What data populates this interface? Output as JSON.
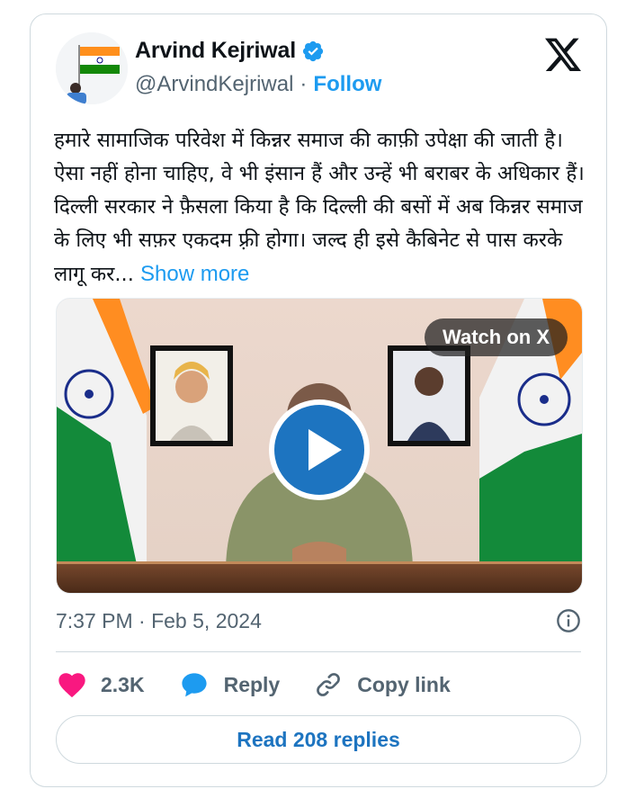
{
  "author": {
    "name": "Arvind Kejriwal",
    "handle": "@ArvindKejriwal",
    "separator": "·",
    "follow_label": "Follow"
  },
  "tweet": {
    "text": "हमारे सामाजिक परिवेश में किन्नर समाज की काफ़ी उपेक्षा की जाती है। ऐसा नहीं होना चाहिए, वे भी इंसान हैं और उन्हें भी बराबर के अधिकार हैं। दिल्ली सरकार ने फ़ैसला किया है कि दिल्ली की बसों में अब किन्नर समाज के लिए भी सफ़र एकदम फ़्री होगा। जल्द ही इसे कैबिनेट से पास करके लागू कर...",
    "show_more_label": "Show more"
  },
  "media": {
    "watch_label": "Watch on X"
  },
  "meta": {
    "timestamp": "7:37 PM · Feb 5, 2024"
  },
  "actions": {
    "likes_count": "2.3K",
    "reply_label": "Reply",
    "copy_link_label": "Copy link"
  },
  "read_replies_label": "Read 208 replies",
  "colors": {
    "accent": "#1d9bf0",
    "like": "#f91880",
    "text_secondary": "#536471",
    "border": "#cfd9de"
  },
  "icons": [
    "verified-badge-icon",
    "x-logo-icon",
    "play-icon",
    "info-icon",
    "heart-icon",
    "reply-bubble-icon",
    "link-icon"
  ]
}
